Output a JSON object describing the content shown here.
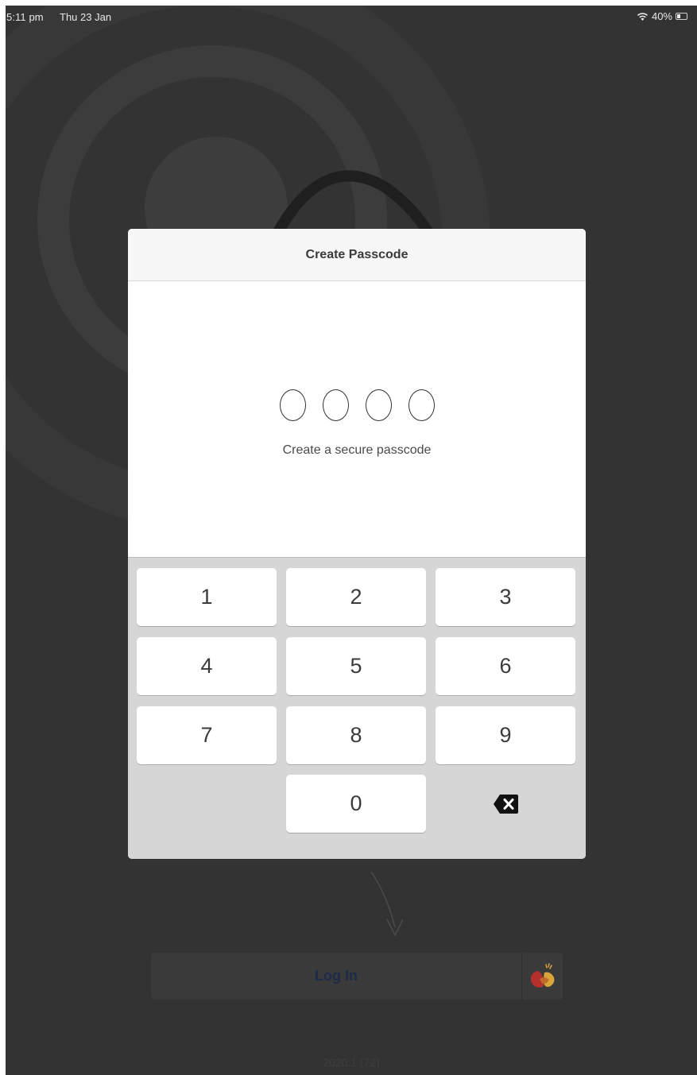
{
  "status_bar": {
    "time": "5:11 pm",
    "date": "Thu 23 Jan",
    "battery_percent": "40%",
    "battery_level": 0.4
  },
  "dialog": {
    "title": "Create Passcode",
    "hint": "Create a secure passcode",
    "passcode_length": 4,
    "entered_digits": 0
  },
  "keypad": {
    "keys": [
      "1",
      "2",
      "3",
      "4",
      "5",
      "6",
      "7",
      "8",
      "9",
      "0"
    ],
    "delete_icon": "backspace-icon"
  },
  "login": {
    "label": "Log In",
    "logo_icon": "app-logo-icon"
  },
  "version": "2020.1 (72)",
  "colors": {
    "background": "#333333",
    "keypad_bg": "#d6d6d6",
    "login_text": "#1e2a4a"
  }
}
